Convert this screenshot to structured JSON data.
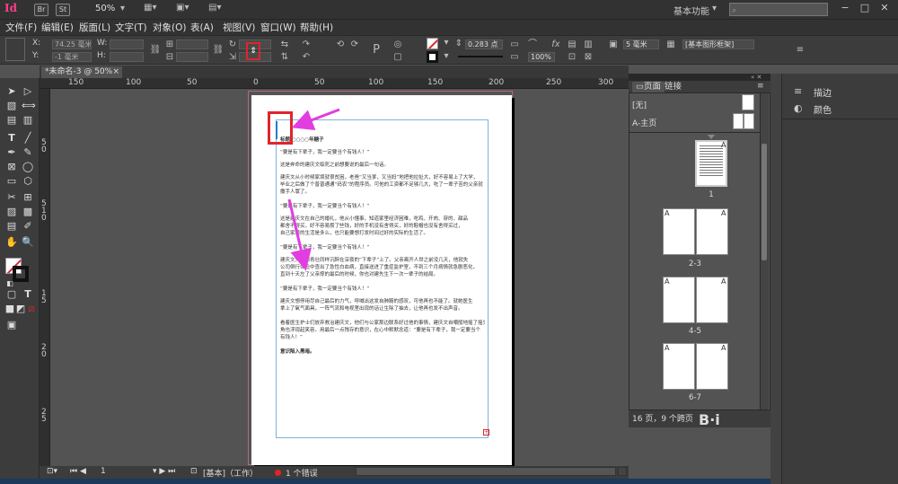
{
  "app": {
    "logo": "Id",
    "bridge_btn": "Br",
    "stock_btn": "St",
    "zoom": "50%",
    "workspace": "基本功能",
    "search_placeholder": ""
  },
  "menu": [
    "文件(F)",
    "编辑(E)",
    "版面(L)",
    "文字(T)",
    "对象(O)",
    "表(A)",
    "视图(V)",
    "窗口(W)",
    "帮助(H)"
  ],
  "control": {
    "x_label": "X:",
    "x_value": "74.25 毫米",
    "y_label": "Y:",
    "y_value": "-1 毫米",
    "w_label": "W:",
    "h_label": "H:",
    "stroke_weight": "0.283 点",
    "opacity": "100%",
    "frame_value": "5 毫米",
    "style_value": "[基本图形框架]"
  },
  "doc_tab": "*未命名-3 @ 50%",
  "ruler": {
    "h": [
      "150",
      "100",
      "50",
      "0",
      "50",
      "100",
      "150",
      "200",
      "250",
      "300",
      "350"
    ],
    "v": [
      "5",
      "0",
      "5",
      "1",
      "0",
      "1",
      "5",
      "2",
      "0",
      "2",
      "5"
    ]
  },
  "document": {
    "lines": [
      "标题 ○○○○年糖子",
      "“要是有下辈子，我一定要当个有钱人！”",
      "这是奔命的建庆文临死之前想要说的最后一句话。",
      "建庆文从小时候家境就很贫困，老爸“又当爹，又当妈”地把他拉扯大，好不容易上了大学，",
      "毕业之后做了个普普通通“码农”的程序员。可他的工资都不足够几大，吃了一辈子苦的父亲就",
      "撒手人寰了。",
      "“要是有下辈子，我一定要当个有钱人！”",
      "这是建庆文在自己的婚礼，他从小懂事，知道家里经济困难，吃鸡、开肉、穿的、甜品",
      "都舍不得买，好不容易攒了些钱，好的手机没有舍得买，好的鞋帽也没有舍得买过，",
      "自己家境的生活是多么，也只能要想打发时间过好的实际的生活了。",
      "“要是有下辈子，我一定要当个有钱人！”",
      "建庆文只能和青壮同样沉醉在深夜的“下辈子”上了。父亲离开人世之前没几天，他就失",
      "公司倒行体检中查出了急性白血病，直接送进了重症监护室，不到三个月病情就急剧恶化，",
      "直到十天左了父亲撑的最后的时候，你也对建先生下一次一辈子的结局。",
      "“要是有下辈子，我一定要当个有钱人！”",
      "建庆文想停用尽自己最后的力气，呼喊出这发自肺腑的感叹，可他再也不能了。就她医生",
      "拿上了氧气面具，一阵气流和电视里出现的话让生除了抽去，让他再也发不出声音。",
      "看着医生护士们放弃救治建庆文，他们与公家那边联系好过他的事情，建庆文自嘲般地摇了摇头，嘴",
      "角也浮现起笑容，用最后一点残存的意识，在心中默默念道：“要是有下辈子，我一定要当个",
      "有钱人！”",
      "意识陷入黑暗。"
    ]
  },
  "status": {
    "page": "1",
    "mode": "[基本]（工作）",
    "errors": "1 个错误"
  },
  "pages_panel": {
    "tabs": [
      "页面",
      "链接"
    ],
    "none_label": "[无]",
    "master_label": "A-主页",
    "master_letter": "A",
    "spreads": [
      {
        "label": "1"
      },
      {
        "label": "2-3"
      },
      {
        "label": "4-5"
      },
      {
        "label": "6-7"
      }
    ],
    "footer": "16 页，9 个跨页"
  },
  "right_panel": {
    "items": [
      {
        "icon": "stroke-icon",
        "label": "描边"
      },
      {
        "icon": "color-icon",
        "label": "颜色"
      }
    ]
  },
  "colors": {
    "arrow": "#e23de0",
    "red_box": "#e0242c",
    "frame_border": "#7fb3d8",
    "logo": "#ff3d8b"
  }
}
